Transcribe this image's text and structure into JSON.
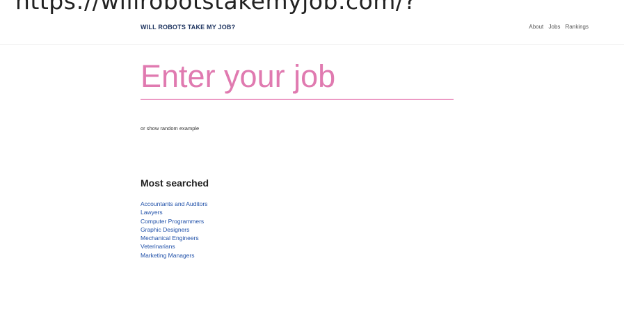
{
  "banner": {
    "url_text": "https://willrobotstakemyjob.com/?"
  },
  "header": {
    "brand": "WILL ROBOTS TAKE MY JOB?",
    "nav": [
      "About",
      "Jobs",
      "Rankings"
    ]
  },
  "search": {
    "placeholder": "Enter your job",
    "random_link": "or show random example"
  },
  "most_searched": {
    "title": "Most searched",
    "items": [
      "Accountants and Auditors",
      "Lawyers",
      "Computer Programmers",
      "Graphic Designers",
      "Mechanical Engineers",
      "Veterinarians",
      "Marketing Managers"
    ]
  },
  "colors": {
    "accent": "#d9388a",
    "brand": "#1f3560",
    "link": "#1e4fa8"
  }
}
